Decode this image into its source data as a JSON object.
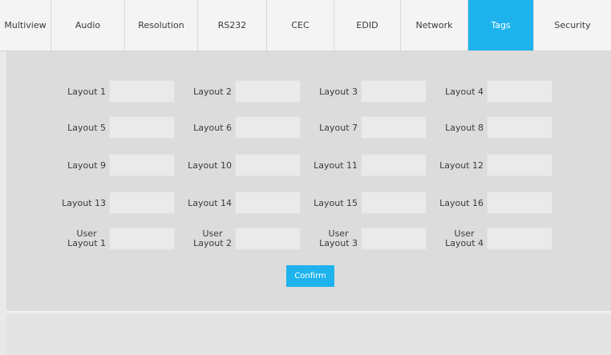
{
  "tabs": [
    {
      "label": "Multiview",
      "active": false
    },
    {
      "label": "Audio",
      "active": false
    },
    {
      "label": "Resolution",
      "active": false
    },
    {
      "label": "RS232",
      "active": false
    },
    {
      "label": "CEC",
      "active": false
    },
    {
      "label": "EDID",
      "active": false
    },
    {
      "label": "Network",
      "active": false
    },
    {
      "label": "Tags",
      "active": true
    },
    {
      "label": "Security",
      "active": false
    }
  ],
  "layouts": {
    "rows": [
      [
        {
          "label": "Layout 1",
          "value": ""
        },
        {
          "label": "Layout 2",
          "value": ""
        },
        {
          "label": "Layout 3",
          "value": ""
        },
        {
          "label": "Layout 4",
          "value": ""
        }
      ],
      [
        {
          "label": "Layout 5",
          "value": ""
        },
        {
          "label": "Layout 6",
          "value": ""
        },
        {
          "label": "Layout 7",
          "value": ""
        },
        {
          "label": "Layout 8",
          "value": ""
        }
      ],
      [
        {
          "label": "Layout 9",
          "value": ""
        },
        {
          "label": "Layout 10",
          "value": ""
        },
        {
          "label": "Layout 11",
          "value": ""
        },
        {
          "label": "Layout 12",
          "value": ""
        }
      ],
      [
        {
          "label": "Layout 13",
          "value": ""
        },
        {
          "label": "Layout 14",
          "value": ""
        },
        {
          "label": "Layout 15",
          "value": ""
        },
        {
          "label": "Layout 16",
          "value": ""
        }
      ],
      [
        {
          "label_line1": "User",
          "label_line2": "Layout 1",
          "value": ""
        },
        {
          "label_line1": "User",
          "label_line2": "Layout 2",
          "value": ""
        },
        {
          "label_line1": "User",
          "label_line2": "Layout 3",
          "value": ""
        },
        {
          "label_line1": "User",
          "label_line2": "Layout 4",
          "value": ""
        }
      ]
    ]
  },
  "confirm_label": "Confirm",
  "colors": {
    "accent": "#1fb3ee",
    "panel": "#dcdcdc",
    "input": "#eaeaea"
  }
}
